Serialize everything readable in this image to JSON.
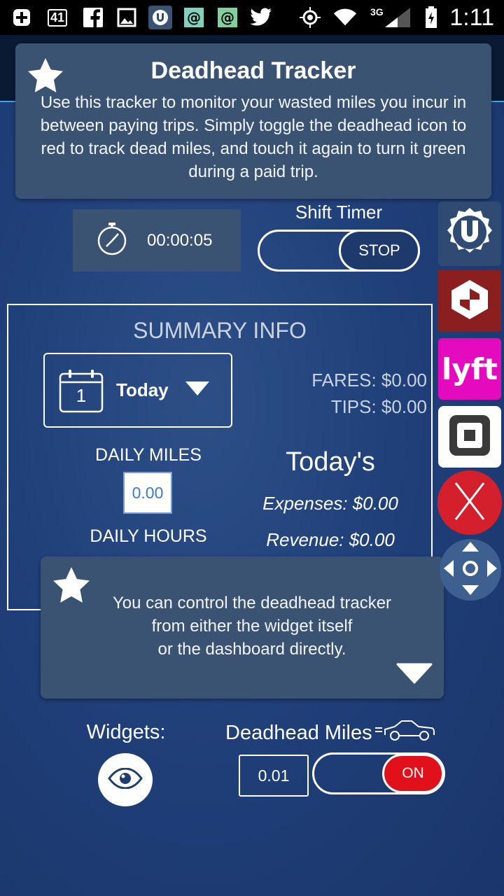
{
  "status_bar": {
    "badge": "41",
    "network": "3G",
    "time": "1:11"
  },
  "intro_tip": {
    "title": "Deadhead Tracker",
    "body": "Use this tracker to monitor your wasted miles you incur in between paying trips. Simply toggle the deadhead icon to red to track dead miles, and touch it again to turn it green during a paid trip."
  },
  "timer": {
    "elapsed": "00:00:05",
    "shift_label": "Shift Timer",
    "shift_button": "STOP"
  },
  "summary": {
    "title": "SUMMARY INFO",
    "date_day": "1",
    "date_label": "Today",
    "fares": "FARES: $0.00",
    "tips": "TIPS: $0.00",
    "daily_miles_label": "DAILY MILES",
    "daily_miles_value": "0.00",
    "daily_hours_label": "DAILY HOURS",
    "todays_label": "Today's",
    "expenses": "Expenses: $0.00",
    "revenue": "Revenue: $0.00"
  },
  "control_tip": {
    "line1": "You can control the deadhead tracker",
    "line2": "from either the widget itself",
    "line3": "or the dashboard directly."
  },
  "bottom": {
    "widgets_label": "Widgets:",
    "deadhead_label": "Deadhead Miles",
    "deadhead_value": "0.01",
    "deadhead_toggle": "ON"
  },
  "apps": {
    "lyft_text": "lyft"
  },
  "colors": {
    "background": "#20407a",
    "card": "#3b5373",
    "toggle_on": "#e0111b",
    "accent_line": "#3fa4e0"
  }
}
